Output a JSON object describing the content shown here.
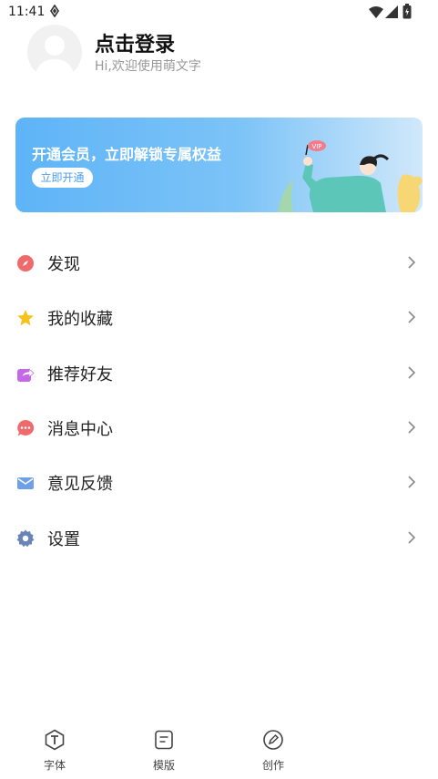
{
  "status_bar": {
    "time": "11:41"
  },
  "profile": {
    "title": "点击登录",
    "subtitle": "Hi,欢迎使用萌文字"
  },
  "vip_banner": {
    "title": "开通会员，立即解锁专属权益",
    "button_label": "立即开通",
    "badge": "VIP"
  },
  "menu": [
    {
      "label": "发现",
      "icon": "compass-icon",
      "color": "#ef6b6b"
    },
    {
      "label": "我的收藏",
      "icon": "star-icon",
      "color": "#f8c21c"
    },
    {
      "label": "推荐好友",
      "icon": "share-icon",
      "color": "#c468e8"
    },
    {
      "label": "消息中心",
      "icon": "message-icon",
      "color": "#ef6b6b"
    },
    {
      "label": "意见反馈",
      "icon": "mail-icon",
      "color": "#6f9fe8"
    },
    {
      "label": "设置",
      "icon": "gear-icon",
      "color": "#6a84b8"
    }
  ],
  "tabbar": [
    {
      "label": "字体",
      "icon": "font-icon"
    },
    {
      "label": "模版",
      "icon": "template-icon"
    },
    {
      "label": "创作",
      "icon": "pen-icon"
    }
  ],
  "colors": {
    "accent": "#4a9ef0",
    "banner_start": "#5eb4f7",
    "banner_end": "#d0e8fb"
  }
}
